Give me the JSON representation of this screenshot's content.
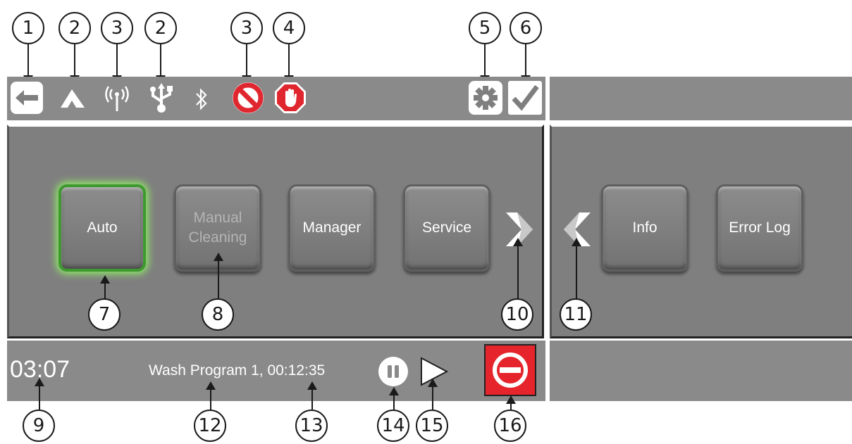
{
  "callouts": {
    "c1": "1",
    "c2a": "2",
    "c3a": "3",
    "c2b": "2",
    "c3b": "3",
    "c4": "4",
    "c5": "5",
    "c6": "6",
    "c7": "7",
    "c8": "8",
    "c10": "10",
    "c11": "11",
    "c9": "9",
    "c12": "12",
    "c13": "13",
    "c14": "14",
    "c15": "15",
    "c16": "16"
  },
  "status_icons": [
    "back-icon",
    "network-icon",
    "wireless-icon",
    "usb-icon",
    "bluetooth-icon",
    "prohibited-icon",
    "stop-hand-icon",
    "gear-icon",
    "check-icon"
  ],
  "menu": {
    "tiles": [
      {
        "label": "Auto",
        "state": "selected"
      },
      {
        "label": "Manual\nCleaning",
        "state": "disabled"
      },
      {
        "label": "Manager",
        "state": "normal"
      },
      {
        "label": "Service",
        "state": "normal"
      }
    ],
    "next_icon": "chevron-right-icon",
    "page2_tiles": [
      {
        "label": "Info"
      },
      {
        "label": "Error Log"
      }
    ],
    "prev_icon": "chevron-left-icon"
  },
  "bottom": {
    "time": "03:07",
    "program": "Wash Program 1, 00:12:35",
    "pause_icon": "pause-icon",
    "play_icon": "play-icon",
    "stop_icon": "stop-minus-icon"
  },
  "colors": {
    "panel": "#7f7f7f",
    "bar": "#8a8a8a",
    "selected_glow": "#3e9a2f",
    "stop_red": "#e5252b",
    "alert_red": "#e0262e"
  }
}
